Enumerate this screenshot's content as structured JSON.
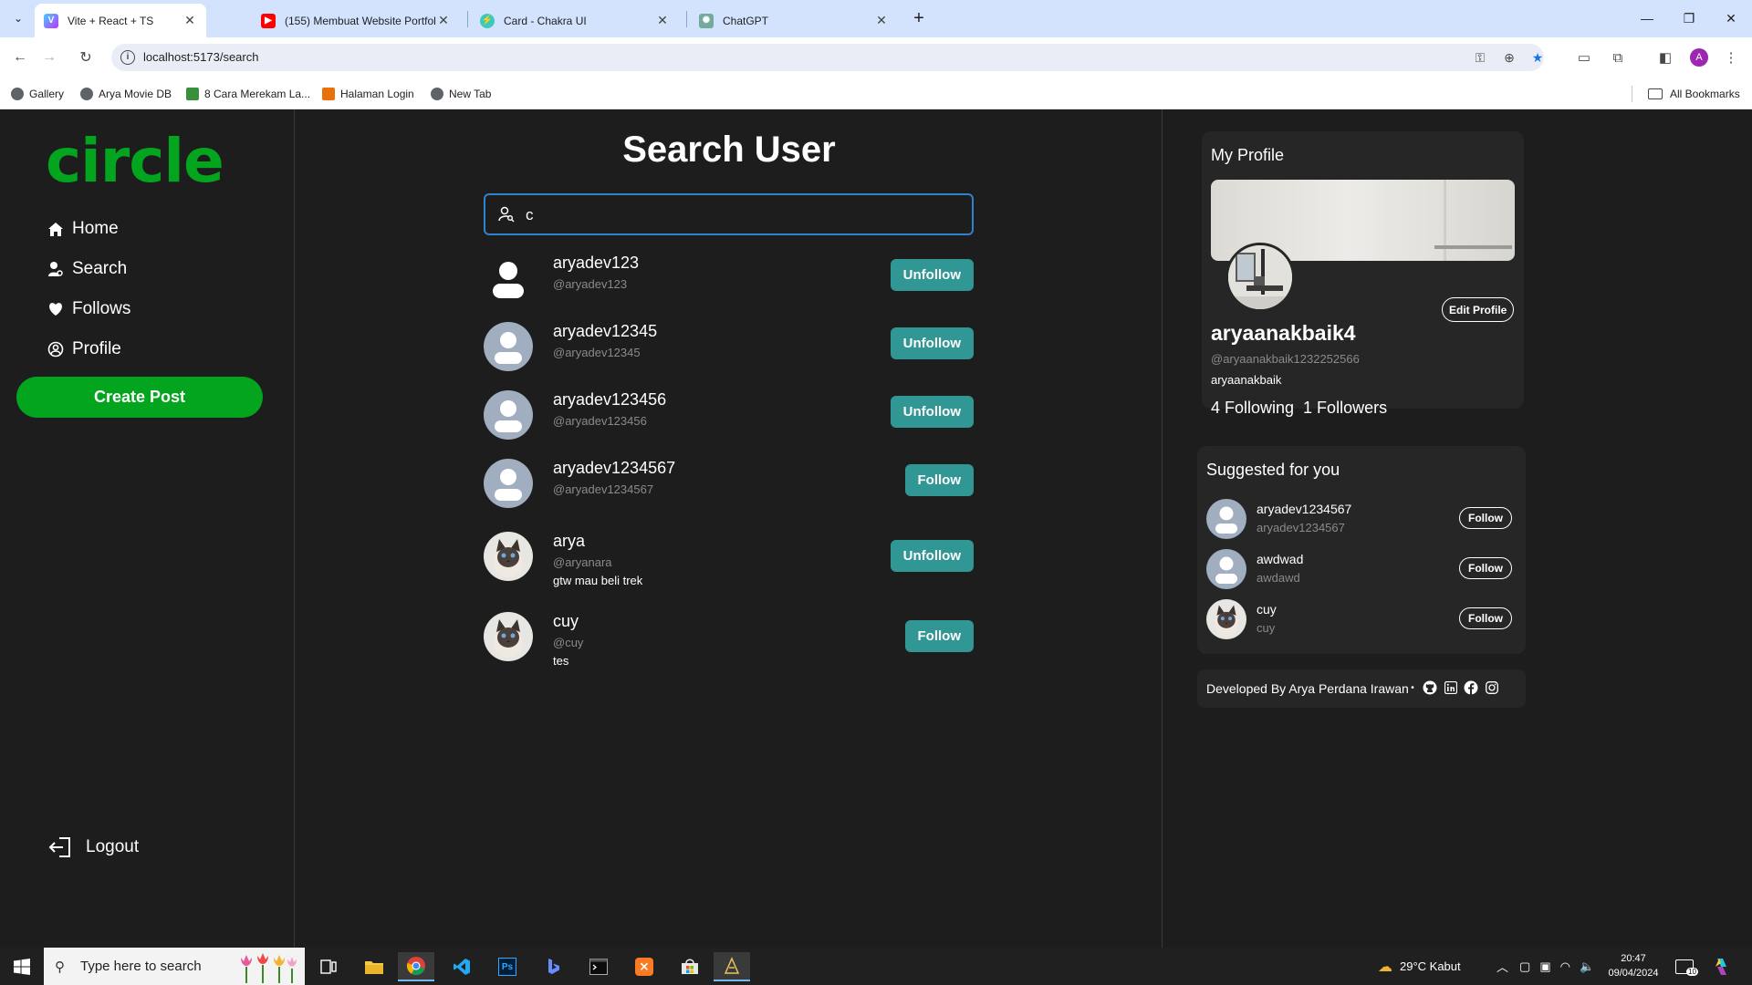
{
  "browser": {
    "tabs": [
      {
        "title": "Vite + React + TS",
        "active": true
      },
      {
        "title": "(155) Membuat Website Portfol",
        "active": false
      },
      {
        "title": "Card - Chakra UI",
        "active": false
      },
      {
        "title": "ChatGPT",
        "active": false
      }
    ],
    "url": "localhost:5173/search",
    "profile_initial": "A",
    "bookmarks": [
      {
        "label": "Gallery"
      },
      {
        "label": "Arya Movie DB"
      },
      {
        "label": "8 Cara Merekam La..."
      },
      {
        "label": "Halaman Login"
      },
      {
        "label": "New Tab"
      }
    ],
    "all_bookmarks_label": "All Bookmarks"
  },
  "sidebar": {
    "logo": "circle",
    "nav": [
      {
        "label": "Home",
        "icon": "home-icon"
      },
      {
        "label": "Search",
        "icon": "user-search-icon"
      },
      {
        "label": "Follows",
        "icon": "heart-icon"
      },
      {
        "label": "Profile",
        "icon": "user-circle-icon"
      }
    ],
    "create_post_label": "Create Post",
    "logout_label": "Logout",
    "accent_color": "#04a51e"
  },
  "search": {
    "title": "Search User",
    "query": "c",
    "results": [
      {
        "name": "aryadev123",
        "handle": "@aryadev123",
        "bio": "",
        "button": "Unfollow",
        "avatar": "default-dark"
      },
      {
        "name": "aryadev12345",
        "handle": "@aryadev12345",
        "bio": "",
        "button": "Unfollow",
        "avatar": "default-gray"
      },
      {
        "name": "aryadev123456",
        "handle": "@aryadev123456",
        "bio": "",
        "button": "Unfollow",
        "avatar": "default-gray"
      },
      {
        "name": "aryadev1234567",
        "handle": "@aryadev1234567",
        "bio": "",
        "button": "Follow",
        "avatar": "default-gray"
      },
      {
        "name": "arya",
        "handle": "@aryanara",
        "bio": "gtw mau beli trek",
        "button": "Unfollow",
        "avatar": "cat-photo"
      },
      {
        "name": "cuy",
        "handle": "@cuy",
        "bio": "tes",
        "button": "Follow",
        "avatar": "cat-photo"
      }
    ],
    "button_color": "#319795"
  },
  "profile": {
    "title": "My Profile",
    "edit_label": "Edit Profile",
    "name": "aryaanakbaik4",
    "handle": "@aryaanakbaik1232252566",
    "bio": "aryaanakbaik",
    "following": "4 Following",
    "followers": "1 Followers"
  },
  "suggested": {
    "title": "Suggested for you",
    "items": [
      {
        "name": "aryadev1234567",
        "handle": "aryadev1234567",
        "button": "Follow",
        "avatar": "default-gray"
      },
      {
        "name": "awdwad",
        "handle": "awdawd",
        "button": "Follow",
        "avatar": "default-gray"
      },
      {
        "name": "cuy",
        "handle": "cuy",
        "button": "Follow",
        "avatar": "cat-photo"
      }
    ]
  },
  "footer": {
    "text": "Developed By Arya Perdana Irawan",
    "separator": "•"
  },
  "taskbar": {
    "search_placeholder": "Type here to search",
    "weather": "29°C  Kabut",
    "time": "20:47",
    "date": "09/04/2024",
    "notification_count": "10"
  }
}
